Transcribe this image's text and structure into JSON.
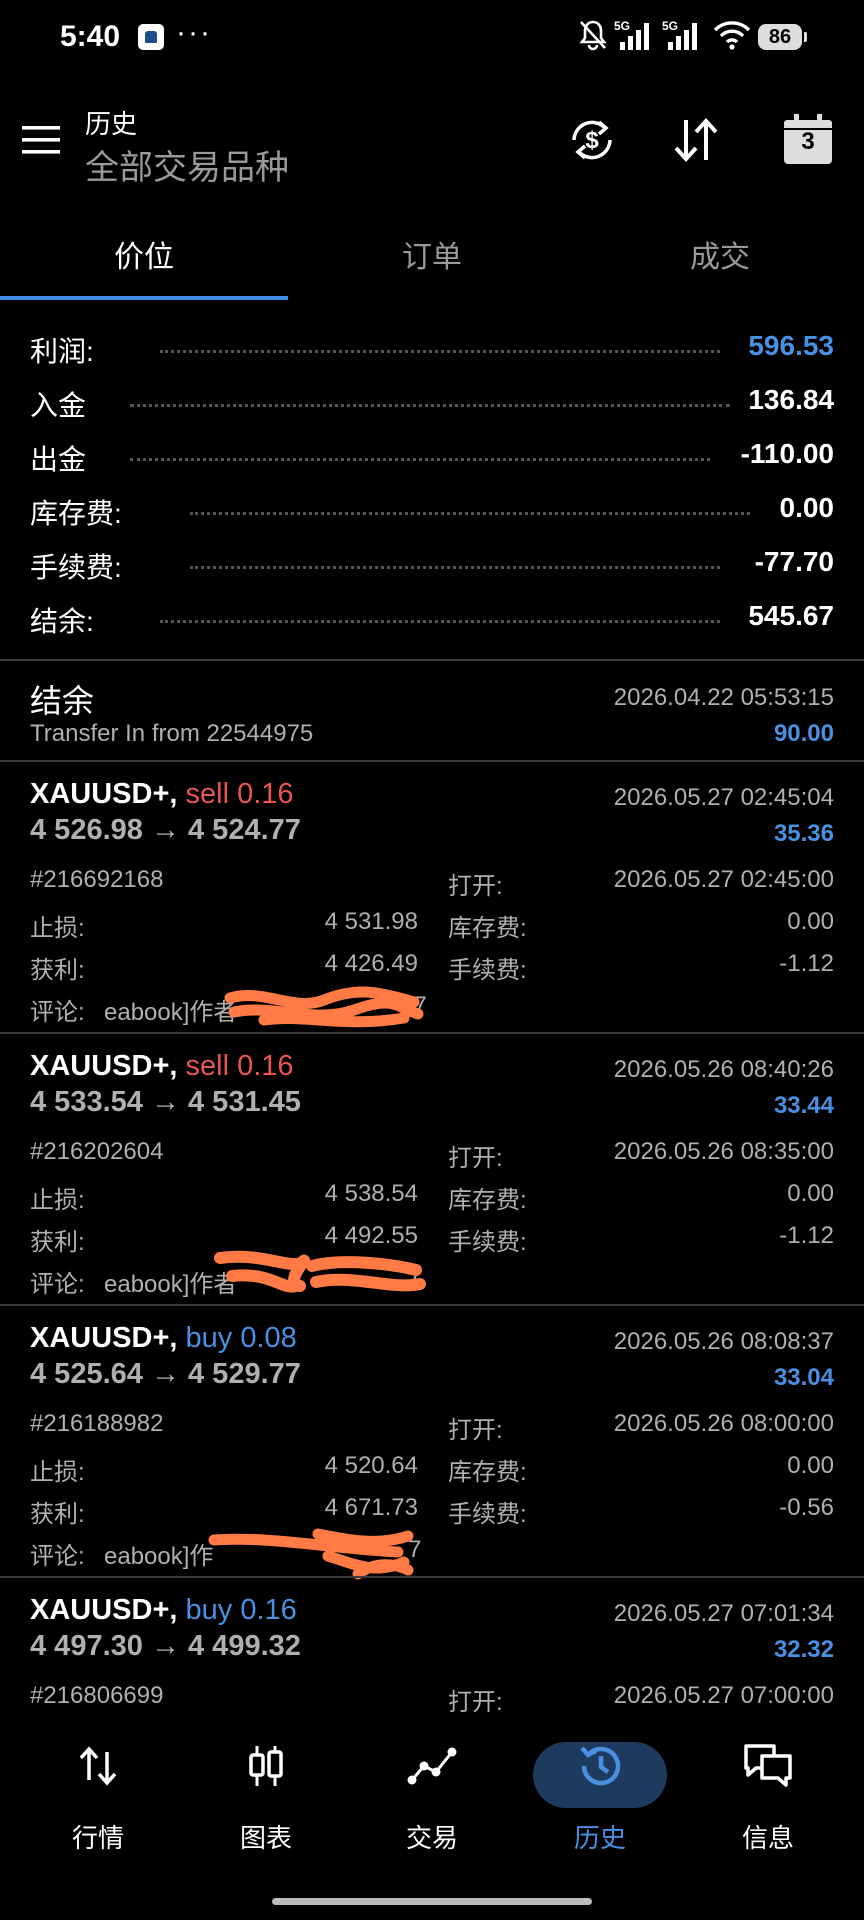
{
  "status_bar": {
    "time": "5:40",
    "more": "···",
    "battery": "86"
  },
  "header": {
    "title": "历史",
    "subtitle": "全部交易品种",
    "calendar_day": "3"
  },
  "tabs": [
    {
      "label": "价位",
      "active": true
    },
    {
      "label": "订单",
      "active": false
    },
    {
      "label": "成交",
      "active": false
    }
  ],
  "summary": [
    {
      "label": "利润:",
      "value": "596.53",
      "highlight": true
    },
    {
      "label": "入金",
      "value": "136.84"
    },
    {
      "label": "出金",
      "value": "-110.00"
    },
    {
      "label": "库存费:",
      "value": "0.00"
    },
    {
      "label": "手续费:",
      "value": "-77.70"
    },
    {
      "label": "结余:",
      "value": "545.67"
    }
  ],
  "balance_entry": {
    "title": "结余",
    "comment": "Transfer In from 22544975",
    "time": "2026.04.22 05:53:15",
    "amount": "90.00"
  },
  "deals": [
    {
      "symbol": "XAUUSD+,",
      "side": "sell 0.16",
      "side_type": "sell",
      "prices": "4 526.98 → 4 524.77",
      "time": "2026.05.27 02:45:04",
      "profit": "35.36",
      "ticket": "#216692168",
      "open_label": "打开:",
      "open_time": "2026.05.27 02:45:00",
      "sl_label": "止损:",
      "sl": "4 531.98",
      "swap_label": "库存费:",
      "swap": "0.00",
      "tp_label": "获利:",
      "tp": "4 426.49",
      "commission_label": "手续费:",
      "commission": "-1.12",
      "comment_label": "评论:",
      "comment": "eabook]作者",
      "comment_tail": "17"
    },
    {
      "symbol": "XAUUSD+,",
      "side": "sell 0.16",
      "side_type": "sell",
      "prices": "4 533.54 → 4 531.45",
      "time": "2026.05.26 08:40:26",
      "profit": "33.44",
      "ticket": "#216202604",
      "open_label": "打开:",
      "open_time": "2026.05.26 08:35:00",
      "sl_label": "止损:",
      "sl": "4 538.54",
      "swap_label": "库存费:",
      "swap": "0.00",
      "tp_label": "获利:",
      "tp": "4 492.55",
      "commission_label": "手续费:",
      "commission": "-1.12",
      "comment_label": "评论:",
      "comment": "eabook]作者",
      "comment_tail": "7"
    },
    {
      "symbol": "XAUUSD+,",
      "side": "buy 0.08",
      "side_type": "buy",
      "prices": "4 525.64 → 4 529.77",
      "time": "2026.05.26 08:08:37",
      "profit": "33.04",
      "ticket": "#216188982",
      "open_label": "打开:",
      "open_time": "2026.05.26 08:00:00",
      "sl_label": "止损:",
      "sl": "4 520.64",
      "swap_label": "库存费:",
      "swap": "0.00",
      "tp_label": "获利:",
      "tp": "4 671.73",
      "commission_label": "手续费:",
      "commission": "-0.56",
      "comment_label": "评论:",
      "comment": "eabook]作",
      "comment_tail": "7"
    },
    {
      "symbol": "XAUUSD+,",
      "side": "buy 0.16",
      "side_type": "buy",
      "prices": "4 497.30 → 4 499.32",
      "time": "2026.05.27 07:01:34",
      "profit": "32.32",
      "ticket": "#216806699",
      "open_label": "打开:",
      "open_time": "2026.05.27 07:00:00"
    }
  ],
  "bottom_nav": [
    {
      "label": "行情",
      "icon": "quotes-icon"
    },
    {
      "label": "图表",
      "icon": "chart-icon"
    },
    {
      "label": "交易",
      "icon": "trade-icon"
    },
    {
      "label": "历史",
      "icon": "history-icon",
      "active": true
    },
    {
      "label": "信息",
      "icon": "messages-icon"
    }
  ],
  "colors": {
    "accent": "#4a90e2",
    "sell": "#e8574f",
    "active_nav_bg": "#1f3a5f",
    "background": "#000000"
  }
}
